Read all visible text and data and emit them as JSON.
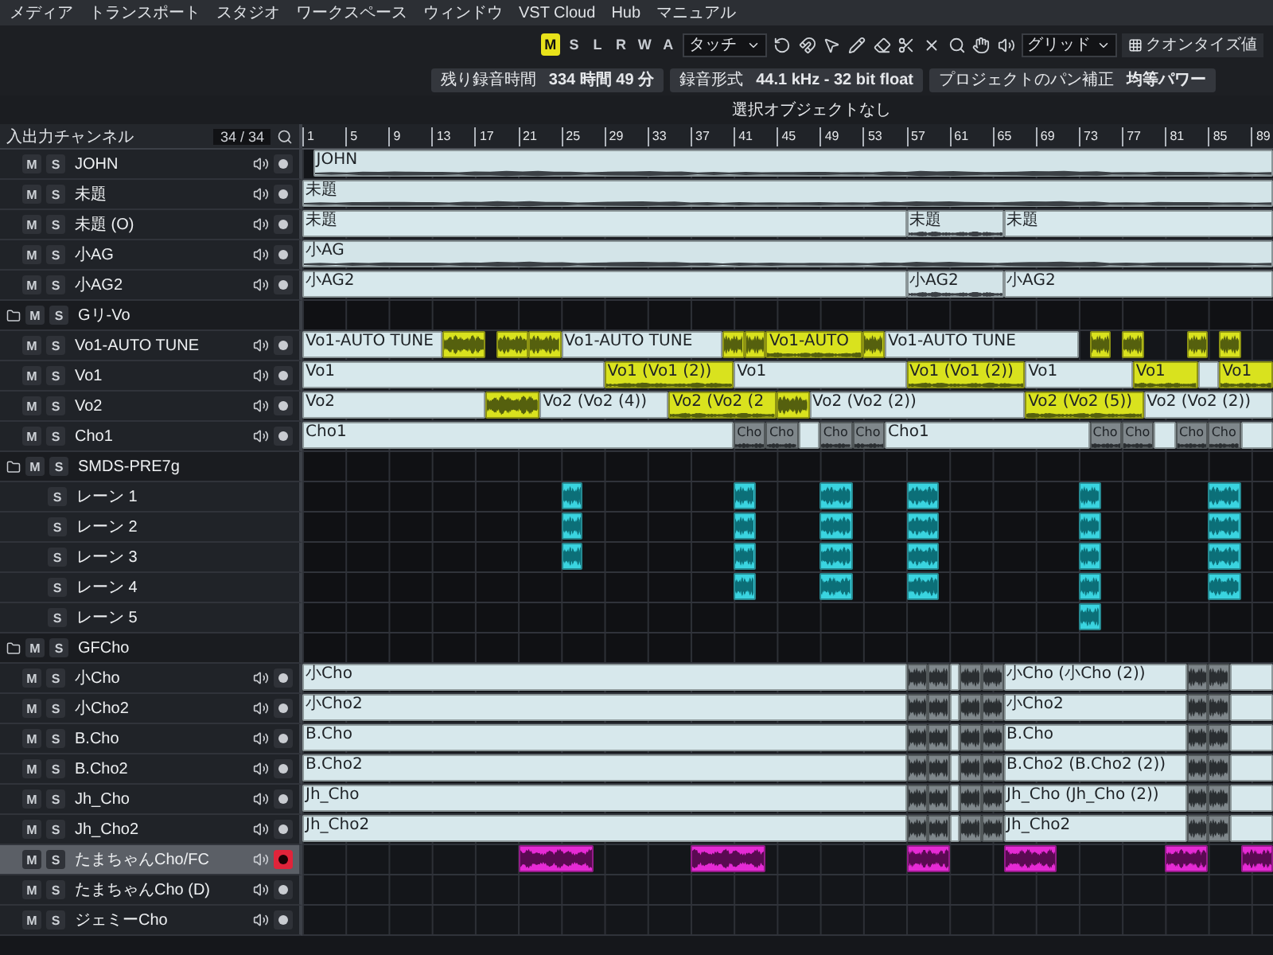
{
  "menu": [
    "メディア",
    "トランスポート",
    "スタジオ",
    "ワークスペース",
    "ウィンドウ",
    "VST Cloud",
    "Hub",
    "マニュアル"
  ],
  "toolbar": {
    "modes": [
      {
        "label": "M",
        "selected": true
      },
      {
        "label": "S",
        "selected": false
      },
      {
        "label": "L",
        "selected": false
      },
      {
        "label": "R",
        "selected": false
      },
      {
        "label": "W",
        "selected": false
      },
      {
        "label": "A",
        "selected": false
      }
    ],
    "automation_mode": "タッチ",
    "snap": "グリッド",
    "quantize": "クオンタイズ値"
  },
  "info": [
    {
      "label": "残り録音時間",
      "value": "334 時間 49 分"
    },
    {
      "label": "録音形式",
      "value": "44.1 kHz - 32 bit float"
    },
    {
      "label": "プロジェクトのパン補正",
      "value": "均等パワー"
    }
  ],
  "selection_status": "選択オブジェクトなし",
  "track_list": {
    "title": "入出力チャンネル",
    "count": "34 / 34"
  },
  "ruler": [
    "1",
    "5",
    "9",
    "13",
    "17",
    "21",
    "25",
    "29",
    "33",
    "37",
    "41",
    "45",
    "49",
    "53",
    "57",
    "61",
    "65",
    "69",
    "73",
    "77",
    "81",
    "85",
    "89"
  ],
  "tracks": [
    {
      "kind": "audio",
      "name": "JOHN",
      "mute": "M",
      "solo": "S",
      "selected": false,
      "armed": false,
      "clips": [
        {
          "kind": "audio",
          "label": "JOHN"
        }
      ]
    },
    {
      "kind": "audio",
      "name": "未題",
      "mute": "M",
      "solo": "S",
      "selected": false,
      "armed": false,
      "clips": [
        {
          "kind": "audio",
          "label": "未題"
        }
      ]
    },
    {
      "kind": "audio",
      "name": "未題 (O)",
      "mute": "M",
      "solo": "S",
      "selected": false,
      "armed": false,
      "clips": [
        {
          "kind": "region",
          "label": "未題"
        },
        {
          "kind": "audio",
          "label": "未題"
        },
        {
          "kind": "region",
          "label": "未題"
        }
      ]
    },
    {
      "kind": "audio",
      "name": "小AG",
      "mute": "M",
      "solo": "S",
      "selected": false,
      "armed": false,
      "clips": [
        {
          "kind": "audio",
          "label": "小AG"
        }
      ]
    },
    {
      "kind": "audio",
      "name": "小AG2",
      "mute": "M",
      "solo": "S",
      "selected": false,
      "armed": false,
      "clips": [
        {
          "kind": "region",
          "label": "小AG2"
        },
        {
          "kind": "audio",
          "label": "小AG2"
        },
        {
          "kind": "region",
          "label": "小AG2"
        }
      ]
    },
    {
      "kind": "folder",
      "name": "Gリ-Vo",
      "mute": "M",
      "solo": "S",
      "selected": false
    },
    {
      "kind": "audio",
      "name": "Vo1-AUTO TUNE",
      "mute": "M",
      "solo": "S",
      "selected": false,
      "armed": false,
      "clips": [
        {
          "kind": "region",
          "label": "Vo1-AUTO TUNE"
        },
        {
          "kind": "take"
        },
        {
          "kind": "take"
        },
        {
          "kind": "take"
        },
        {
          "kind": "region",
          "label": "Vo1-AUTO TUNE"
        },
        {
          "kind": "take"
        },
        {
          "kind": "take"
        },
        {
          "kind": "take",
          "label": "Vo1-AUTO"
        },
        {
          "kind": "take"
        },
        {
          "kind": "region",
          "label": "Vo1-AUTO TUNE"
        },
        {
          "kind": "take"
        },
        {
          "kind": "take"
        },
        {
          "kind": "take"
        },
        {
          "kind": "take"
        }
      ]
    },
    {
      "kind": "audio",
      "name": "Vo1",
      "mute": "M",
      "solo": "S",
      "selected": false,
      "armed": false,
      "clips": [
        {
          "kind": "region",
          "label": "Vo1"
        },
        {
          "kind": "take",
          "label": "Vo1 (Vo1 (2))"
        },
        {
          "kind": "region",
          "label": "Vo1"
        },
        {
          "kind": "take",
          "label": "Vo1 (Vo1 (2))"
        },
        {
          "kind": "region",
          "label": "Vo1"
        },
        {
          "kind": "take",
          "label": "Vo1"
        },
        {
          "kind": "region"
        },
        {
          "kind": "take",
          "label": "Vo1"
        }
      ]
    },
    {
      "kind": "audio",
      "name": "Vo2",
      "mute": "M",
      "solo": "S",
      "selected": false,
      "armed": false,
      "clips": [
        {
          "kind": "region",
          "label": "Vo2"
        },
        {
          "kind": "take"
        },
        {
          "kind": "region",
          "label": "Vo2 (Vo2 (4))"
        },
        {
          "kind": "take",
          "label": "Vo2 (Vo2 (2"
        },
        {
          "kind": "take"
        },
        {
          "kind": "region",
          "label": "Vo2 (Vo2 (2))"
        },
        {
          "kind": "take",
          "label": "Vo2 (Vo2 (5))"
        },
        {
          "kind": "region",
          "label": "Vo2 (Vo2 (2))"
        }
      ]
    },
    {
      "kind": "audio",
      "name": "Cho1",
      "mute": "M",
      "solo": "S",
      "selected": false,
      "armed": false,
      "clips": [
        {
          "kind": "region",
          "label": "Cho1"
        },
        {
          "kind": "event",
          "label": "Cho"
        },
        {
          "kind": "event",
          "label": "Cho"
        },
        {
          "kind": "region"
        },
        {
          "kind": "event",
          "label": "Cho"
        },
        {
          "kind": "event",
          "label": "Cho"
        },
        {
          "kind": "region",
          "label": "Cho1"
        },
        {
          "kind": "event",
          "label": "Cho"
        },
        {
          "kind": "event",
          "label": "Cho"
        },
        {
          "kind": "region"
        },
        {
          "kind": "event",
          "label": "Cho"
        },
        {
          "kind": "event",
          "label": "Cho"
        },
        {
          "kind": "region"
        }
      ]
    },
    {
      "kind": "folder",
      "name": "SMDS-PRE7g",
      "mute": "M",
      "solo": "S",
      "selected": false
    },
    {
      "kind": "lane",
      "name": "レーン 1",
      "solo": "S",
      "selected": false,
      "clips": [
        {
          "kind": "cue"
        },
        {
          "kind": "cue"
        },
        {
          "kind": "cue"
        },
        {
          "kind": "cue"
        },
        {
          "kind": "cue"
        },
        {
          "kind": "cue"
        }
      ]
    },
    {
      "kind": "lane",
      "name": "レーン 2",
      "solo": "S",
      "selected": false,
      "clips": [
        {
          "kind": "cue"
        },
        {
          "kind": "cue"
        },
        {
          "kind": "cue"
        },
        {
          "kind": "cue"
        },
        {
          "kind": "cue"
        },
        {
          "kind": "cue"
        }
      ]
    },
    {
      "kind": "lane",
      "name": "レーン 3",
      "solo": "S",
      "selected": false,
      "clips": [
        {
          "kind": "cue"
        },
        {
          "kind": "cue"
        },
        {
          "kind": "cue"
        },
        {
          "kind": "cue"
        },
        {
          "kind": "cue"
        },
        {
          "kind": "cue"
        }
      ]
    },
    {
      "kind": "lane",
      "name": "レーン 4",
      "solo": "S",
      "selected": false,
      "clips": [
        {
          "kind": "cue"
        },
        {
          "kind": "cue"
        },
        {
          "kind": "cue"
        },
        {
          "kind": "cue"
        },
        {
          "kind": "cue"
        }
      ]
    },
    {
      "kind": "lane",
      "name": "レーン 5",
      "solo": "S",
      "selected": false,
      "clips": [
        {
          "kind": "cue"
        }
      ]
    },
    {
      "kind": "folder",
      "name": "GFCho",
      "mute": "M",
      "solo": "S",
      "selected": false
    },
    {
      "kind": "audio",
      "name": "小Cho",
      "mute": "M",
      "solo": "S",
      "selected": false,
      "armed": false,
      "clips": [
        {
          "kind": "region",
          "label": "小Cho"
        },
        {
          "kind": "event"
        },
        {
          "kind": "event"
        },
        {
          "kind": "region"
        },
        {
          "kind": "event"
        },
        {
          "kind": "event"
        },
        {
          "kind": "region",
          "label": "小Cho (小Cho (2))"
        },
        {
          "kind": "event"
        },
        {
          "kind": "event"
        },
        {
          "kind": "region"
        }
      ]
    },
    {
      "kind": "audio",
      "name": "小Cho2",
      "mute": "M",
      "solo": "S",
      "selected": false,
      "armed": false,
      "clips": [
        {
          "kind": "region",
          "label": "小Cho2"
        },
        {
          "kind": "event"
        },
        {
          "kind": "event"
        },
        {
          "kind": "region"
        },
        {
          "kind": "event"
        },
        {
          "kind": "event"
        },
        {
          "kind": "region",
          "label": "小Cho2"
        },
        {
          "kind": "event"
        },
        {
          "kind": "event"
        },
        {
          "kind": "region"
        }
      ]
    },
    {
      "kind": "audio",
      "name": "B.Cho",
      "mute": "M",
      "solo": "S",
      "selected": false,
      "armed": false,
      "clips": [
        {
          "kind": "region",
          "label": "B.Cho"
        },
        {
          "kind": "event"
        },
        {
          "kind": "event"
        },
        {
          "kind": "region"
        },
        {
          "kind": "event"
        },
        {
          "kind": "event"
        },
        {
          "kind": "region",
          "label": "B.Cho"
        },
        {
          "kind": "event"
        },
        {
          "kind": "event"
        },
        {
          "kind": "region"
        }
      ]
    },
    {
      "kind": "audio",
      "name": "B.Cho2",
      "mute": "M",
      "solo": "S",
      "selected": false,
      "armed": false,
      "clips": [
        {
          "kind": "region",
          "label": "B.Cho2"
        },
        {
          "kind": "event"
        },
        {
          "kind": "event"
        },
        {
          "kind": "region"
        },
        {
          "kind": "event"
        },
        {
          "kind": "event"
        },
        {
          "kind": "region",
          "label": "B.Cho2 (B.Cho2 (2))"
        },
        {
          "kind": "event"
        },
        {
          "kind": "event"
        },
        {
          "kind": "region"
        }
      ]
    },
    {
      "kind": "audio",
      "name": "Jh_Cho",
      "mute": "M",
      "solo": "S",
      "selected": false,
      "armed": false,
      "clips": [
        {
          "kind": "region",
          "label": "Jh_Cho"
        },
        {
          "kind": "event"
        },
        {
          "kind": "event"
        },
        {
          "kind": "region"
        },
        {
          "kind": "event"
        },
        {
          "kind": "event"
        },
        {
          "kind": "region",
          "label": "Jh_Cho (Jh_Cho (2))"
        },
        {
          "kind": "event"
        },
        {
          "kind": "event"
        },
        {
          "kind": "region"
        }
      ]
    },
    {
      "kind": "audio",
      "name": "Jh_Cho2",
      "mute": "M",
      "solo": "S",
      "selected": false,
      "armed": false,
      "clips": [
        {
          "kind": "region",
          "label": "Jh_Cho2"
        },
        {
          "kind": "event"
        },
        {
          "kind": "event"
        },
        {
          "kind": "region"
        },
        {
          "kind": "event"
        },
        {
          "kind": "event"
        },
        {
          "kind": "region",
          "label": "Jh_Cho2"
        },
        {
          "kind": "event"
        },
        {
          "kind": "event"
        },
        {
          "kind": "region"
        }
      ]
    },
    {
      "kind": "audio",
      "name": "たまちゃんCho/FC",
      "mute": "M",
      "solo": "S",
      "selected": true,
      "armed": true,
      "clips": [
        {
          "kind": "pink"
        },
        {
          "kind": "pink"
        },
        {
          "kind": "pink"
        },
        {
          "kind": "pink"
        },
        {
          "kind": "pink"
        },
        {
          "kind": "pink"
        }
      ]
    },
    {
      "kind": "audio",
      "name": "たまちゃんCho (D)",
      "mute": "M",
      "solo": "S",
      "selected": false,
      "armed": false
    },
    {
      "kind": "audio",
      "name": "ジェミーCho",
      "mute": "M",
      "solo": "S",
      "selected": false,
      "armed": false
    }
  ]
}
